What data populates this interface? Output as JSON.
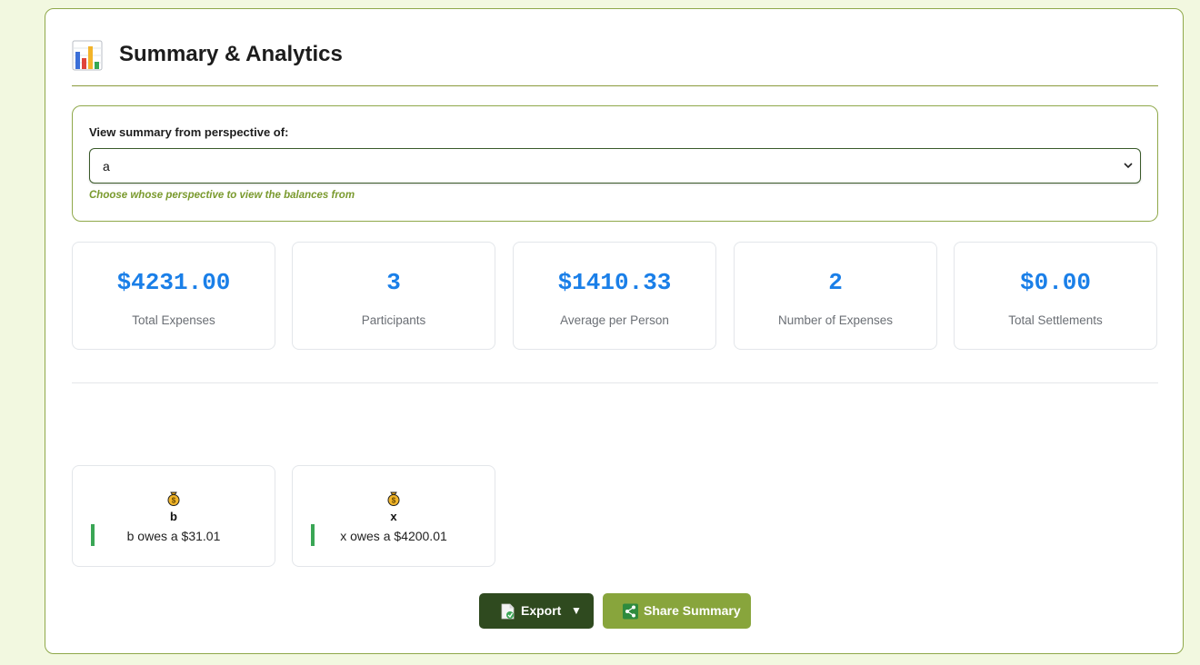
{
  "header": {
    "title": "Summary & Analytics",
    "icon": "bar-chart-icon"
  },
  "perspective": {
    "label": "View summary from perspective of:",
    "selected": "a",
    "hint": "Choose whose perspective to view the balances from"
  },
  "stats": [
    {
      "value": "$4231.00",
      "label": "Total Expenses"
    },
    {
      "value": "3",
      "label": "Participants"
    },
    {
      "value": "$1410.33",
      "label": "Average per Person"
    },
    {
      "value": "2",
      "label": "Number of Expenses"
    },
    {
      "value": "$0.00",
      "label": "Total Settlements"
    }
  ],
  "balances": [
    {
      "name": "b",
      "text": "b owes a $31.01",
      "icon": "money-bag-icon"
    },
    {
      "name": "x",
      "text": "x owes a $4200.01",
      "icon": "money-bag-icon"
    }
  ],
  "actions": {
    "export_label": "Export",
    "export_caret": "▼",
    "share_label": "Share Summary"
  },
  "colors": {
    "background": "#f2f8e0",
    "accent": "#8fa84a",
    "stat_value": "#1a7fe8",
    "export_button": "#2f4a1f",
    "share_button": "#88a53c",
    "owe_bar": "#3aa655"
  }
}
